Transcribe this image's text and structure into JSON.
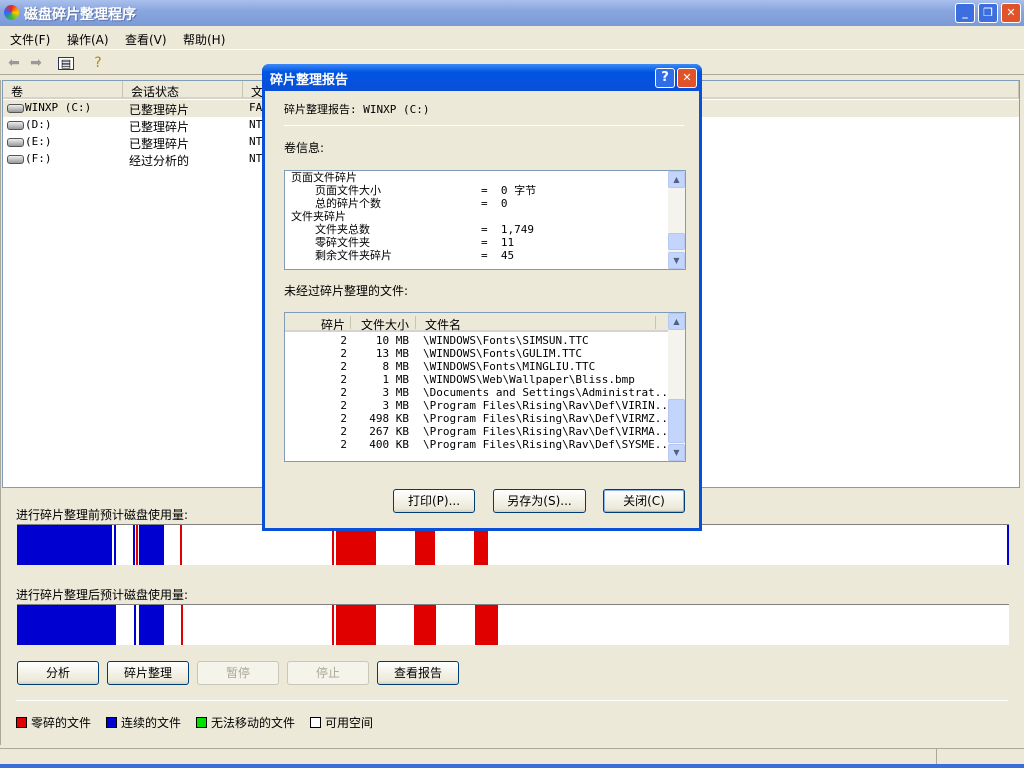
{
  "window": {
    "title": "磁盘碎片整理程序"
  },
  "menu": [
    "文件(F)",
    "操作(A)",
    "查看(V)",
    "帮助(H)"
  ],
  "toolbar": {
    "icons": [
      "back-arrow-icon",
      "forward-arrow-icon",
      "show-hide-tree-icon",
      "help-icon"
    ]
  },
  "volumes": {
    "headers": [
      "卷",
      "会话状态",
      "文"
    ],
    "rows": [
      {
        "name": "WINXP (C:)",
        "status": "已整理碎片",
        "fs": "FA"
      },
      {
        "name": "(D:)",
        "status": "已整理碎片",
        "fs": "NT"
      },
      {
        "name": "(E:)",
        "status": "已整理碎片",
        "fs": "NT"
      },
      {
        "name": "(F:)",
        "status": "经过分析的",
        "fs": "NT"
      }
    ]
  },
  "usage": {
    "before_label": "进行碎片整理前预计磁盘使用量:",
    "after_label": "进行碎片整理后预计磁盘使用量:",
    "before_segments_pct": [
      [
        "blue",
        0,
        9.6
      ],
      [
        "blue",
        9.8,
        10.0
      ],
      [
        "blue",
        11.7,
        11.9
      ],
      [
        "red",
        12.0,
        12.2
      ],
      [
        "blue",
        12.3,
        14.8
      ],
      [
        "red",
        16.4,
        16.6
      ],
      [
        "red",
        31.8,
        32.0
      ],
      [
        "red",
        32.2,
        36.2
      ],
      [
        "red",
        40.1,
        42.1
      ],
      [
        "red",
        46.1,
        47.5
      ],
      [
        "blue",
        99.8,
        100
      ]
    ],
    "after_segments_pct": [
      [
        "blue",
        0,
        10.0
      ],
      [
        "blue",
        11.8,
        12.0
      ],
      [
        "blue",
        12.3,
        14.8
      ],
      [
        "red",
        16.5,
        16.7
      ],
      [
        "red",
        31.8,
        32.0
      ],
      [
        "red",
        32.2,
        36.2
      ],
      [
        "red",
        40.0,
        42.2
      ],
      [
        "red",
        46.2,
        48.5
      ]
    ]
  },
  "buttons": {
    "analyze": "分析",
    "defrag": "碎片整理",
    "pause": "暂停",
    "stop": "停止",
    "view_report": "查看报告"
  },
  "legend": [
    {
      "label": "零碎的文件",
      "color": "#e00000"
    },
    {
      "label": "连续的文件",
      "color": "#0000d0"
    },
    {
      "label": "无法移动的文件",
      "color": "#00e000"
    },
    {
      "label": "可用空间",
      "color": "#ffffff"
    }
  ],
  "colors": {
    "red": "#e00000",
    "blue": "#0000d0"
  },
  "dialog": {
    "title": "碎片整理报告",
    "report_for": "碎片整理报告:  WINXP (C:)",
    "volume_info_label": "卷信息:",
    "volume_info_lines": [
      {
        "label": "页面文件碎片",
        "value": "",
        "indent": false
      },
      {
        "label": "页面文件大小",
        "value": "=  0 字节",
        "indent": true
      },
      {
        "label": "总的碎片个数",
        "value": "=  0",
        "indent": true
      },
      {
        "label": "文件夹碎片",
        "value": "",
        "indent": false
      },
      {
        "label": "文件夹总数",
        "value": "=  1,749",
        "indent": true
      },
      {
        "label": "零碎文件夹",
        "value": "=  11",
        "indent": true
      },
      {
        "label": "剩余文件夹碎片",
        "value": "=  45",
        "indent": true
      }
    ],
    "unfragmented_label": "未经过碎片整理的文件:",
    "file_headers": [
      "碎片",
      "文件大小",
      "文件名"
    ],
    "files": [
      {
        "frag": "2",
        "size": "10 MB",
        "name": "\\WINDOWS\\Fonts\\SIMSUN.TTC"
      },
      {
        "frag": "2",
        "size": "13 MB",
        "name": "\\WINDOWS\\Fonts\\GULIM.TTC"
      },
      {
        "frag": "2",
        "size": "8 MB",
        "name": "\\WINDOWS\\Fonts\\MINGLIU.TTC"
      },
      {
        "frag": "2",
        "size": "1 MB",
        "name": "\\WINDOWS\\Web\\Wallpaper\\Bliss.bmp"
      },
      {
        "frag": "2",
        "size": "3 MB",
        "name": "\\Documents and Settings\\Administrat..."
      },
      {
        "frag": "2",
        "size": "3 MB",
        "name": "\\Program Files\\Rising\\Rav\\Def\\VIRIN..."
      },
      {
        "frag": "2",
        "size": "498 KB",
        "name": "\\Program Files\\Rising\\Rav\\Def\\VIRMZ..."
      },
      {
        "frag": "2",
        "size": "267 KB",
        "name": "\\Program Files\\Rising\\Rav\\Def\\VIRMA..."
      },
      {
        "frag": "2",
        "size": "400 KB",
        "name": "\\Program Files\\Rising\\Rav\\Def\\SYSME..."
      }
    ],
    "buttons": {
      "print": "打印(P)...",
      "save_as": "另存为(S)...",
      "close": "关闭(C)"
    }
  }
}
